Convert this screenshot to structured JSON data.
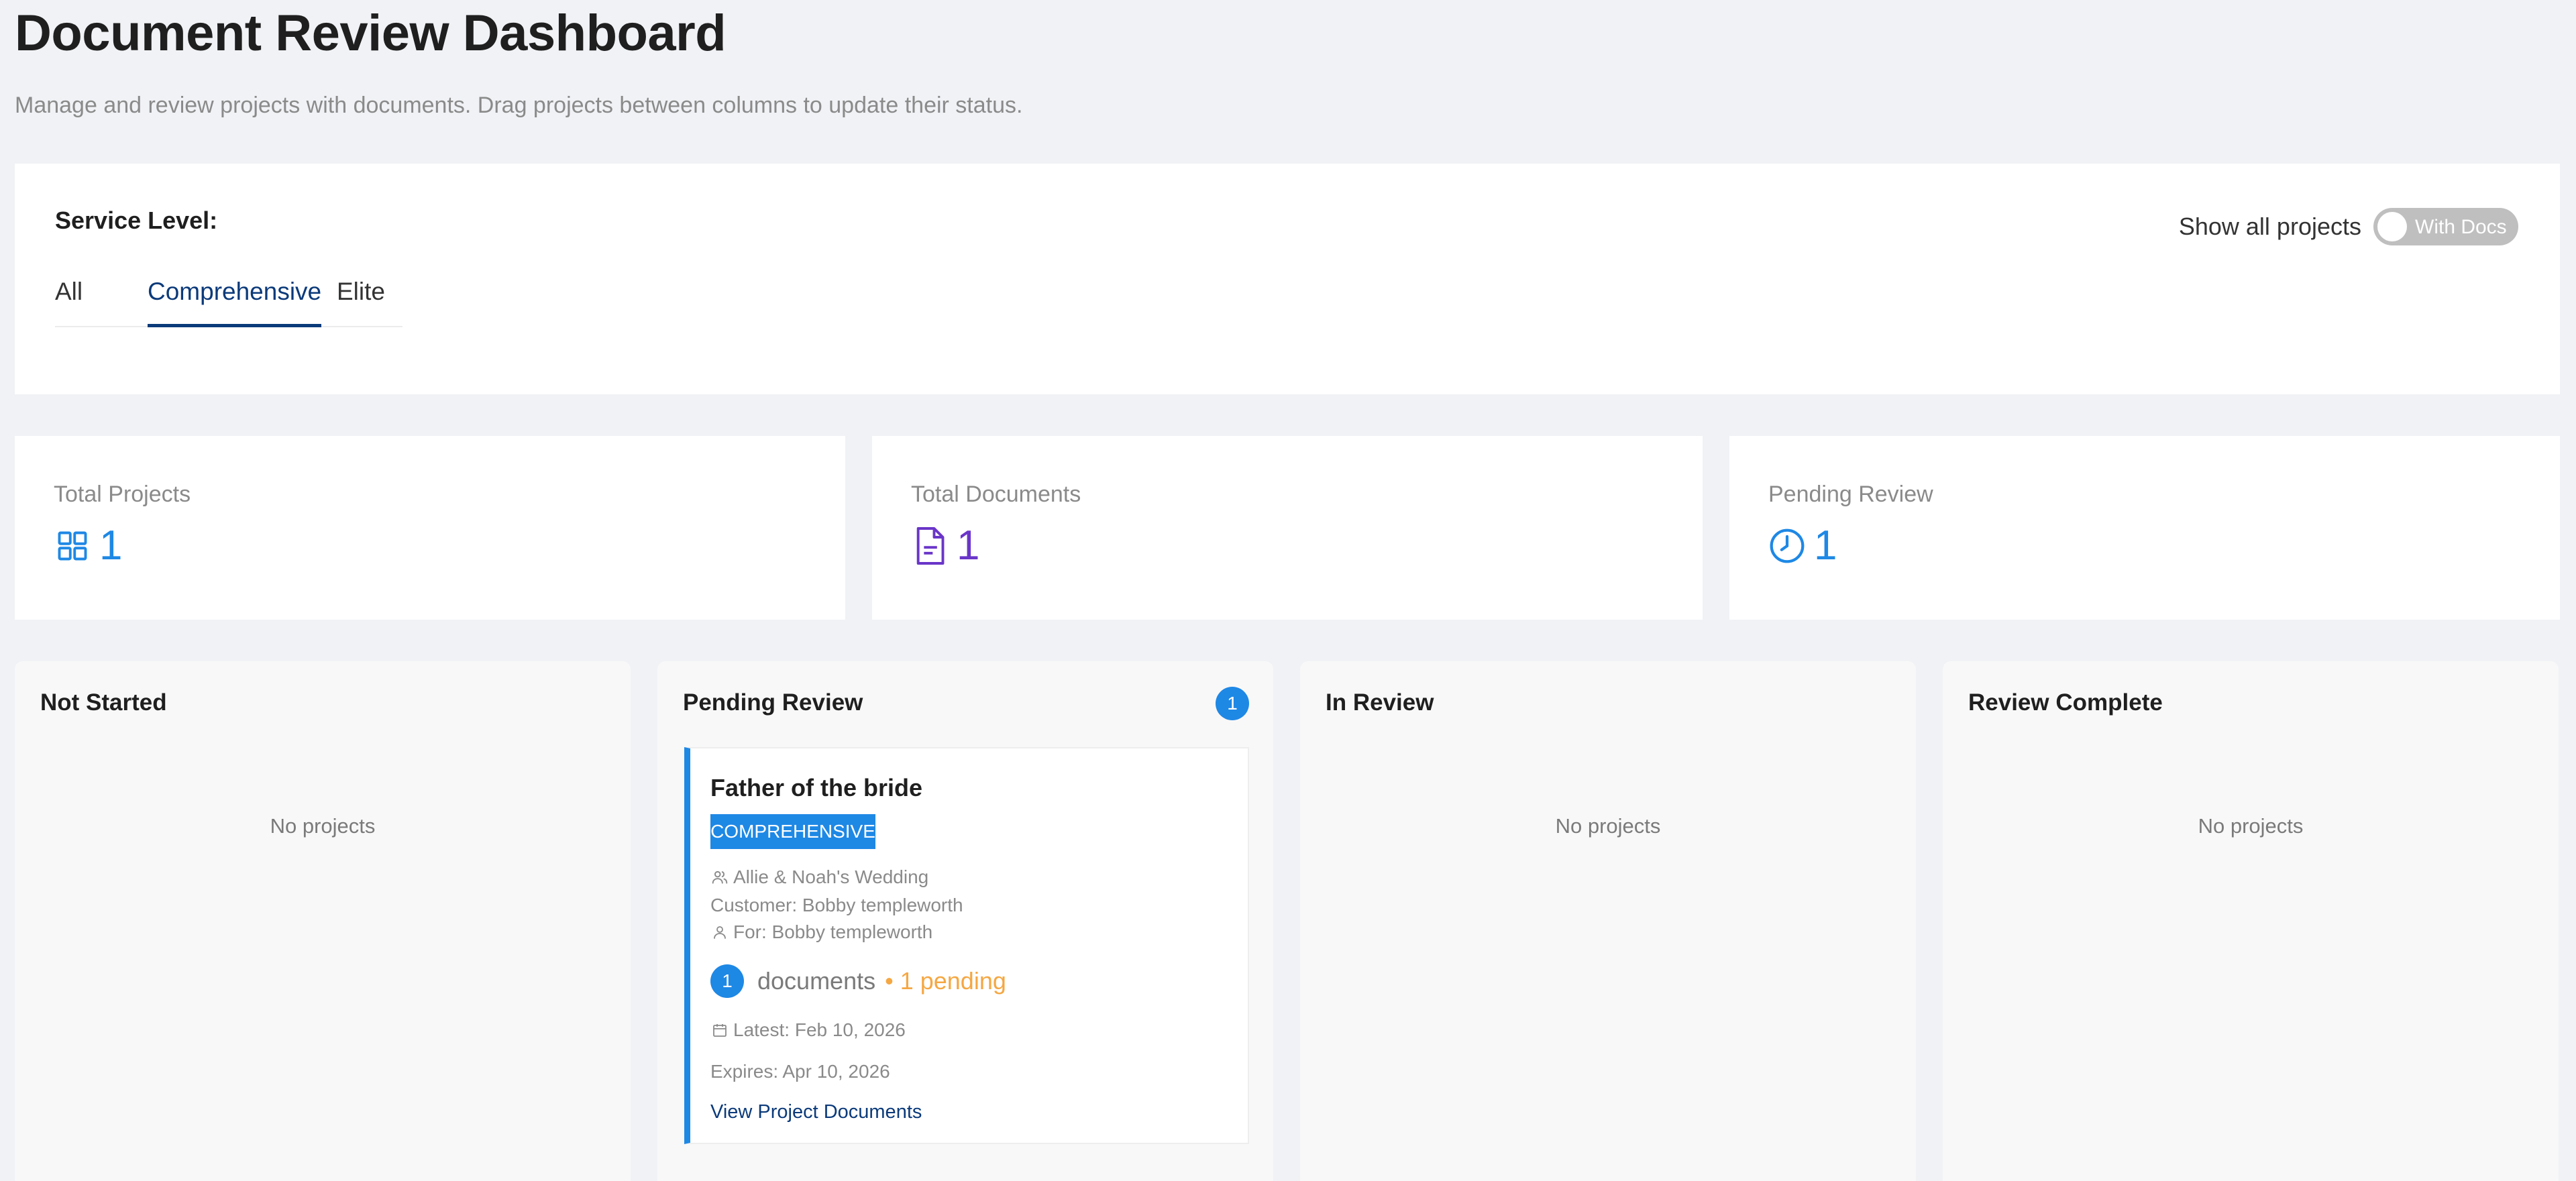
{
  "page": {
    "title": "Document Review Dashboard",
    "subtitle": "Manage and review projects with documents. Drag projects between columns to update their status."
  },
  "filters": {
    "service_level_label": "Service Level:",
    "tabs": [
      {
        "label": "All",
        "active": false
      },
      {
        "label": "Comprehensive",
        "active": true
      },
      {
        "label": "Elite",
        "active": false
      }
    ],
    "show_all_label": "Show all projects",
    "toggle_text": "With Docs",
    "toggle_on": false
  },
  "stats": [
    {
      "title": "Total Projects",
      "value": "1",
      "icon": "grid-icon",
      "color": "#1e88e5"
    },
    {
      "title": "Total Documents",
      "value": "1",
      "icon": "document-icon",
      "color": "#6a35c9"
    },
    {
      "title": "Pending Review",
      "value": "1",
      "icon": "clock-icon",
      "color": "#1e88e5"
    }
  ],
  "columns": [
    {
      "title": "Not Started",
      "empty_text": "No projects"
    },
    {
      "title": "Pending Review",
      "count": "1"
    },
    {
      "title": "In Review",
      "empty_text": "No projects"
    },
    {
      "title": "Review Complete",
      "empty_text": "No projects"
    }
  ],
  "project": {
    "name": "Father of the bride",
    "badge": "COMPREHENSIVE",
    "event": "Allie & Noah's Wedding",
    "customer": "Customer: Bobby templeworth",
    "for": "For: Bobby templeworth",
    "doc_count": "1",
    "doc_label": "documents",
    "pending": "• 1 pending",
    "latest": "Latest: Feb 10, 2026",
    "expires": "Expires: Apr 10, 2026",
    "link": "View Project Documents"
  },
  "colors": {
    "accent": "#1e88e5",
    "navy": "#0b3a7a",
    "purple": "#6a35c9",
    "pending": "#f5a742"
  }
}
